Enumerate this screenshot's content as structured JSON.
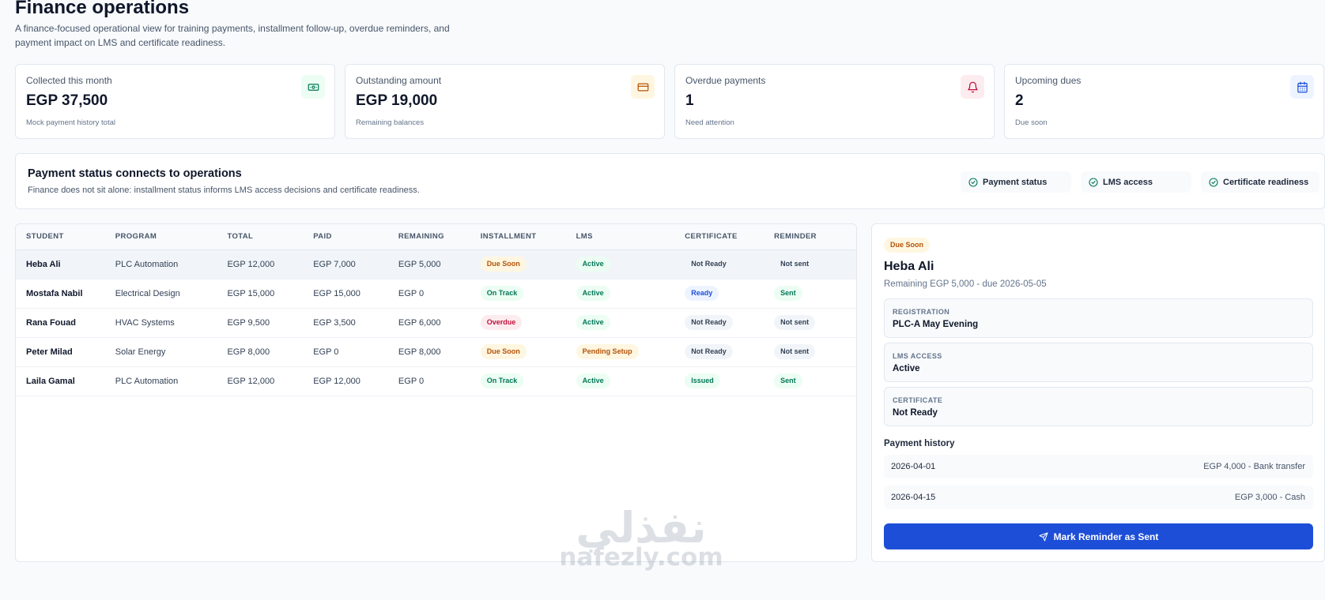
{
  "header": {
    "title": "Finance operations",
    "description": "A finance-focused operational view for training payments, installment follow-up, overdue reminders, and payment impact on LMS and certificate readiness."
  },
  "stats": [
    {
      "label": "Collected this month",
      "value": "EGP 37,500",
      "note": "Mock payment history total",
      "icon": "cash-icon",
      "color": "#047857",
      "bg": "#ecfdf3"
    },
    {
      "label": "Outstanding amount",
      "value": "EGP 19,000",
      "note": "Remaining balances",
      "icon": "credit-card-icon",
      "color": "#b45309",
      "bg": "#fef6e0"
    },
    {
      "label": "Overdue payments",
      "value": "1",
      "note": "Need attention",
      "icon": "bell-icon",
      "color": "#be123c",
      "bg": "#fdecef"
    },
    {
      "label": "Upcoming dues",
      "value": "2",
      "note": "Due soon",
      "icon": "calendar-icon",
      "color": "#1d4ed8",
      "bg": "#eef4ff"
    }
  ],
  "banner": {
    "title": "Payment status connects to operations",
    "description": "Finance does not sit alone: installment status informs LMS access decisions and certificate readiness.",
    "chips": [
      "Payment status",
      "LMS access",
      "Certificate readiness"
    ]
  },
  "table": {
    "columns": [
      "STUDENT",
      "PROGRAM",
      "TOTAL",
      "PAID",
      "REMAINING",
      "INSTALLMENT",
      "LMS",
      "CERTIFICATE",
      "REMINDER"
    ],
    "rows": [
      {
        "student": "Heba Ali",
        "program": "PLC Automation",
        "total": "EGP 12,000",
        "paid": "EGP 7,000",
        "remaining": "EGP 5,000",
        "installment": "Due Soon",
        "lms": "Active",
        "certificate": "Not Ready",
        "reminder": "Not sent"
      },
      {
        "student": "Mostafa Nabil",
        "program": "Electrical Design",
        "total": "EGP 15,000",
        "paid": "EGP 15,000",
        "remaining": "EGP 0",
        "installment": "On Track",
        "lms": "Active",
        "certificate": "Ready",
        "reminder": "Sent"
      },
      {
        "student": "Rana Fouad",
        "program": "HVAC Systems",
        "total": "EGP 9,500",
        "paid": "EGP 3,500",
        "remaining": "EGP 6,000",
        "installment": "Overdue",
        "lms": "Active",
        "certificate": "Not Ready",
        "reminder": "Not sent"
      },
      {
        "student": "Peter Milad",
        "program": "Solar Energy",
        "total": "EGP 8,000",
        "paid": "EGP 0",
        "remaining": "EGP 8,000",
        "installment": "Due Soon",
        "lms": "Pending Setup",
        "certificate": "Not Ready",
        "reminder": "Not sent"
      },
      {
        "student": "Laila Gamal",
        "program": "PLC Automation",
        "total": "EGP 12,000",
        "paid": "EGP 12,000",
        "remaining": "EGP 0",
        "installment": "On Track",
        "lms": "Active",
        "certificate": "Issued",
        "reminder": "Sent"
      }
    ]
  },
  "detail": {
    "status": "Due Soon",
    "name": "Heba Ali",
    "subtitle": "Remaining EGP 5,000 - due 2026-05-05",
    "info": [
      {
        "label": "REGISTRATION",
        "value": "PLC-A May Evening"
      },
      {
        "label": "LMS ACCESS",
        "value": "Active"
      },
      {
        "label": "CERTIFICATE",
        "value": "Not Ready"
      }
    ],
    "history_title": "Payment history",
    "history": [
      {
        "date": "2026-04-01",
        "amount": "EGP 4,000 - Bank transfer"
      },
      {
        "date": "2026-04-15",
        "amount": "EGP 3,000 - Cash"
      }
    ],
    "action_label": "Mark Reminder as Sent"
  },
  "watermark": {
    "arabic": "نفذلي",
    "latin": "nafezly.com"
  },
  "colors": {
    "accent": "#1d4ed8",
    "success": "#047857",
    "warning": "#b45309",
    "danger": "#be123c"
  }
}
